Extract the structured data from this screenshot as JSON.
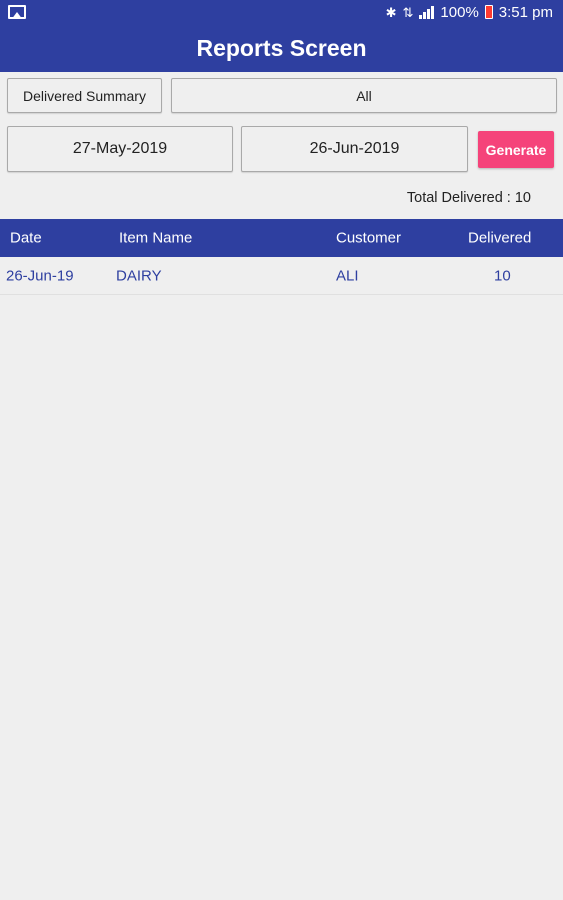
{
  "status_bar": {
    "battery_percent": "100%",
    "time": "3:51 pm",
    "icons": [
      "image-icon",
      "bluetooth-icon",
      "data-transfer-icon",
      "signal-icon",
      "battery-icon"
    ]
  },
  "app_bar": {
    "title": "Reports Screen"
  },
  "filters": {
    "report_type": "Delivered Summary",
    "customer_filter": "All",
    "from_date": "27-May-2019",
    "to_date": "26-Jun-2019",
    "generate_label": "Generate"
  },
  "summary": {
    "total_delivered": "Total Delivered : 10"
  },
  "table": {
    "headers": [
      "Date",
      "Item Name",
      "Customer",
      "Delivered"
    ],
    "rows": [
      [
        "26-Jun-19",
        "DAIRY",
        "ALI",
        "10"
      ]
    ]
  },
  "colors": {
    "primary": "#2e3fa0",
    "accent": "#f5437a",
    "background": "#efefef"
  }
}
